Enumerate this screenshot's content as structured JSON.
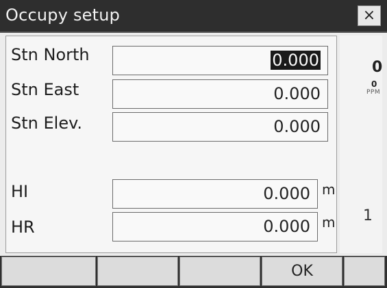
{
  "window": {
    "title": "Occupy setup",
    "close_symbol": "×"
  },
  "fields": [
    {
      "label": "Stn North",
      "value": "0.000",
      "unit": ""
    },
    {
      "label": "Stn East",
      "value": "0.000",
      "unit": ""
    },
    {
      "label": "Stn Elev.",
      "value": "0.000",
      "unit": ""
    },
    {
      "label": "HI",
      "value": "0.000",
      "unit": "m"
    },
    {
      "label": "HR",
      "value": "0.000",
      "unit": "m"
    }
  ],
  "status_bar": {
    "ppm_value": "0",
    "ppm_small_value": "0",
    "ppm_unit": "PPM",
    "mode_number": "1",
    "icons": [
      "battery-icon",
      "prism-icon",
      "laser-icon",
      "tilt-icon",
      "communication-icon",
      "input-mode-icon",
      "memory-card-icon"
    ]
  },
  "softkeys": {
    "labels": [
      "",
      "",
      "",
      "OK",
      ""
    ]
  },
  "colors": {
    "title_bar": "#2e2e2e",
    "background": "#ececec",
    "softkey": "#dcdcdc"
  }
}
